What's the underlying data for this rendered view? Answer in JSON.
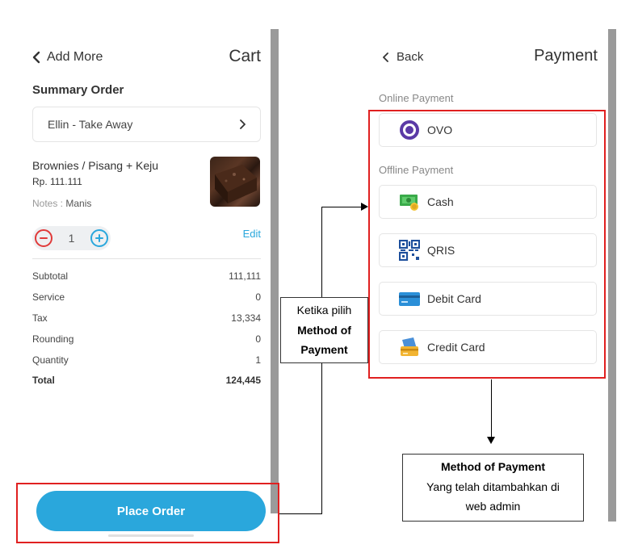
{
  "cart": {
    "back_label": "Add More",
    "title": "Cart",
    "section_title": "Summary Order",
    "customer": "Ellin - Take Away",
    "item": {
      "name": "Brownies / Pisang + Keju",
      "price": "Rp. 111.111",
      "notes_label": "Notes : ",
      "notes_value": "Manis",
      "quantity": "1",
      "edit_label": "Edit",
      "image_icon": "brownie-photo"
    },
    "summary": [
      {
        "label": "Subtotal",
        "value": "111,111"
      },
      {
        "label": "Service",
        "value": "0"
      },
      {
        "label": "Tax",
        "value": "13,334"
      },
      {
        "label": "Rounding",
        "value": "0"
      },
      {
        "label": "Quantity",
        "value": "1"
      },
      {
        "label": "Total",
        "value": "124,445"
      }
    ],
    "place_order_label": "Place Order"
  },
  "payment": {
    "back_label": "Back",
    "title": "Payment",
    "online_label": "Online Payment",
    "offline_label": "Offline Payment",
    "online_methods": [
      {
        "label": "OVO",
        "icon": "ovo-icon"
      }
    ],
    "offline_methods": [
      {
        "label": "Cash",
        "icon": "cash-icon"
      },
      {
        "label": "QRIS",
        "icon": "qris-icon"
      },
      {
        "label": "Debit Card",
        "icon": "debit-card-icon"
      },
      {
        "label": "Credit Card",
        "icon": "credit-card-icon"
      }
    ]
  },
  "annotations": {
    "middle": {
      "line1": "Ketika pilih",
      "line2": "Method of",
      "line3": "Payment"
    },
    "bottom": {
      "line1": "Method of Payment",
      "line2": "Yang telah ditambahkan di",
      "line3": "web admin"
    }
  },
  "colors": {
    "accent": "#2aa7dc",
    "highlight": "#e02020",
    "minus": "#e03a3a"
  }
}
